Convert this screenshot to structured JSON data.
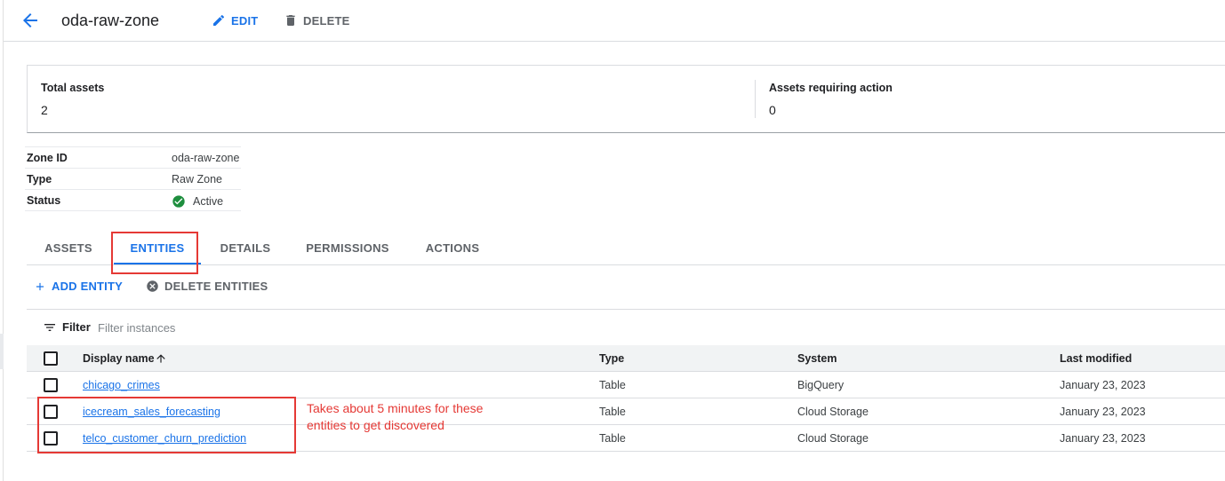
{
  "header": {
    "title": "oda-raw-zone",
    "edit_label": "EDIT",
    "delete_label": "DELETE"
  },
  "summary": {
    "total_assets_label": "Total assets",
    "total_assets_value": "2",
    "assets_action_label": "Assets requiring action",
    "assets_action_value": "0"
  },
  "properties": [
    {
      "key": "Zone ID",
      "value": "oda-raw-zone"
    },
    {
      "key": "Type",
      "value": "Raw Zone"
    },
    {
      "key": "Status",
      "value": "Active"
    }
  ],
  "tabs": [
    {
      "label": "ASSETS"
    },
    {
      "label": "ENTITIES"
    },
    {
      "label": "DETAILS"
    },
    {
      "label": "PERMISSIONS"
    },
    {
      "label": "ACTIONS"
    }
  ],
  "actions": {
    "add_entity": "ADD ENTITY",
    "delete_entities": "DELETE ENTITIES"
  },
  "filter": {
    "label": "Filter",
    "placeholder": "Filter instances"
  },
  "table": {
    "columns": [
      "Display name",
      "Type",
      "System",
      "Last modified"
    ],
    "rows": [
      {
        "name": "chicago_crimes",
        "type": "Table",
        "system": "BigQuery",
        "modified": "January 23, 2023"
      },
      {
        "name": "icecream_sales_forecasting",
        "type": "Table",
        "system": "Cloud Storage",
        "modified": "January 23, 2023"
      },
      {
        "name": "telco_customer_churn_prediction",
        "type": "Table",
        "system": "Cloud Storage",
        "modified": "January 23, 2023"
      }
    ]
  },
  "annotation": "Takes about 5 minutes for these entities to get discovered",
  "colors": {
    "accent": "#1a73e8",
    "status_active": "#1e8e3e",
    "annotation": "#e53935"
  }
}
